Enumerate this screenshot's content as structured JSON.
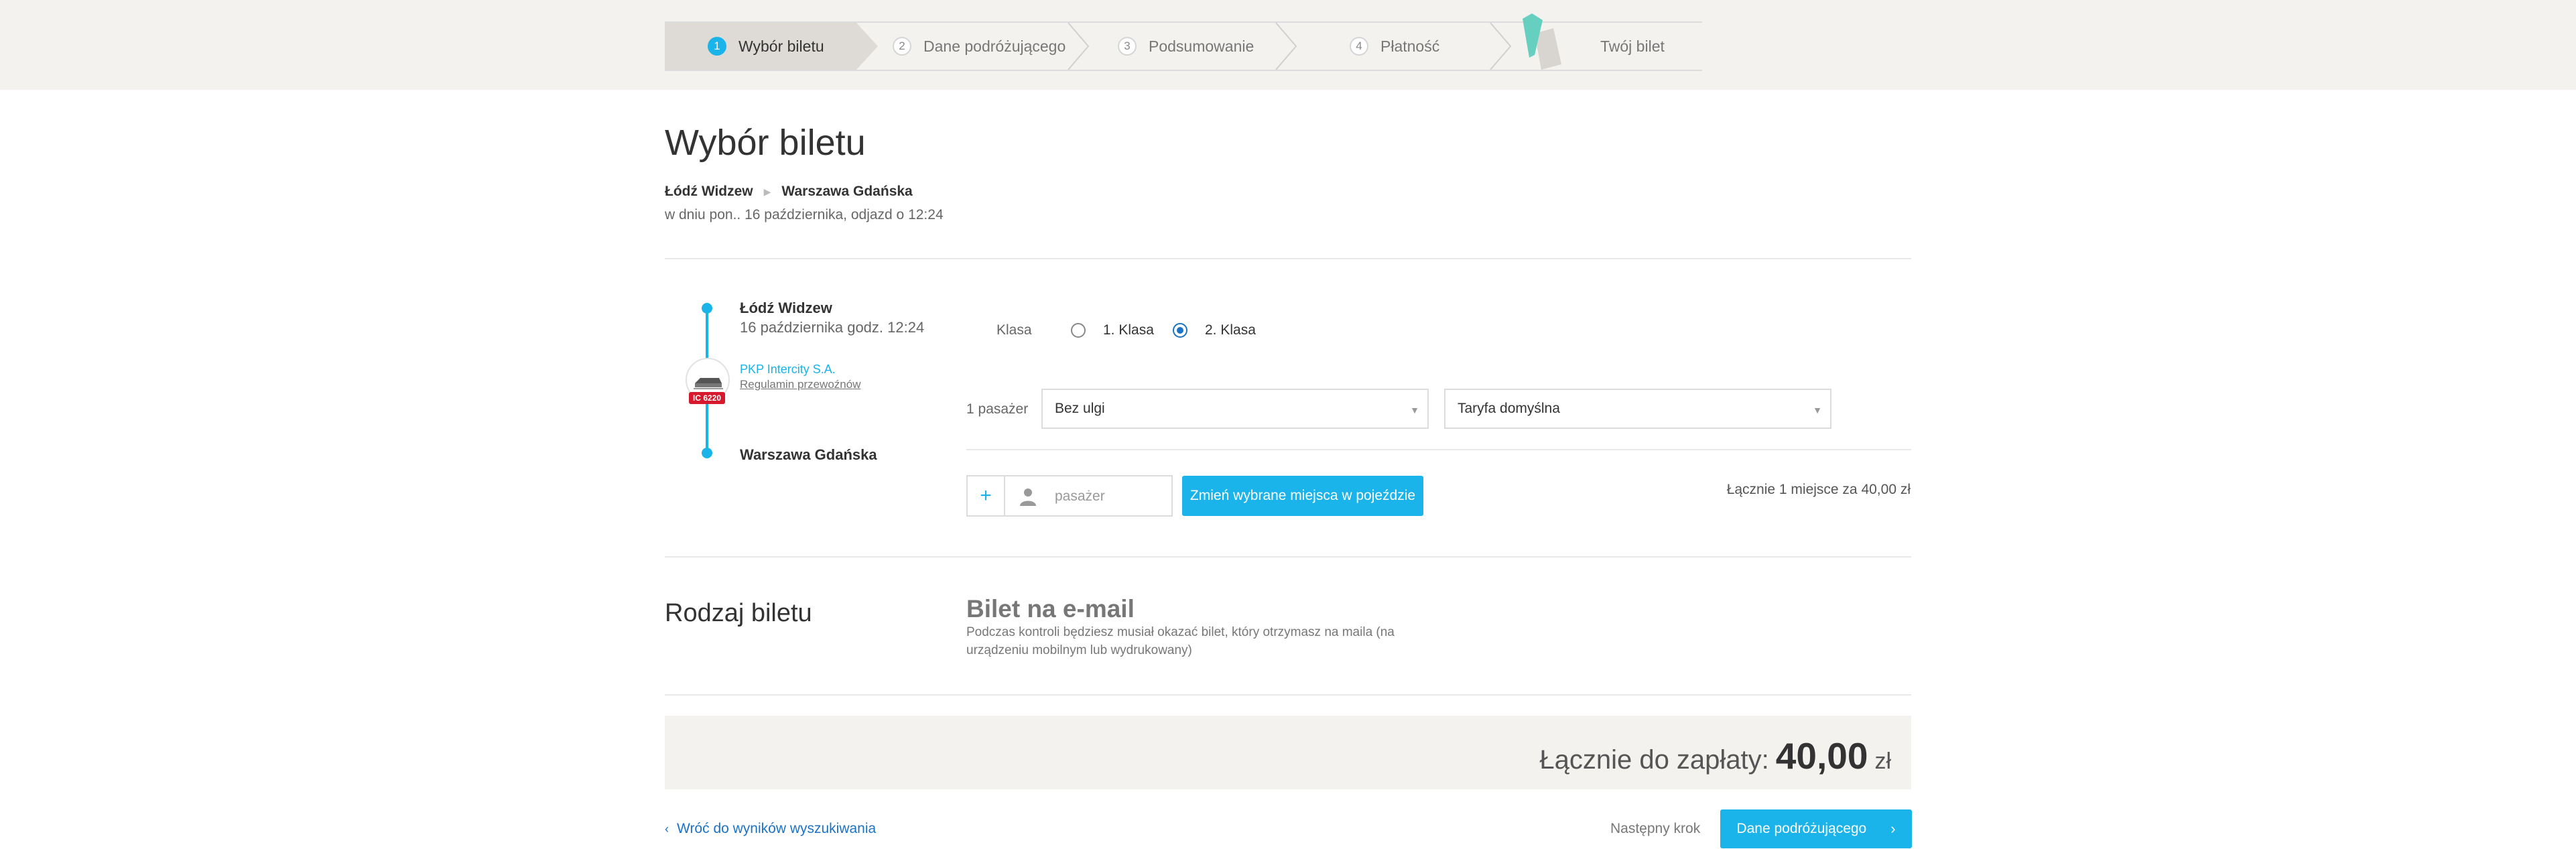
{
  "stepper": {
    "steps": [
      {
        "num": "1",
        "label": "Wybór biletu"
      },
      {
        "num": "2",
        "label": "Dane podróżującego"
      },
      {
        "num": "3",
        "label": "Podsumowanie"
      },
      {
        "num": "4",
        "label": "Płatność"
      },
      {
        "num": "",
        "label": "Twój bilet"
      }
    ],
    "active_index": 0
  },
  "page": {
    "title": "Wybór biletu",
    "route_from": "Łódź Widzew",
    "route_to": "Warszawa Gdańska",
    "route_subtitle": "w dniu pon.. 16 października, odjazd o 12:24"
  },
  "journey": {
    "departure_station": "Łódź Widzew",
    "departure_time": "16 października godz. 12:24",
    "carrier_name": "PKP Intercity S.A.",
    "carrier_rules": "Regulamin przewoźnów",
    "train_badge": "IC 6220",
    "arrival_station": "Warszawa Gdańska"
  },
  "klasa": {
    "label": "Klasa",
    "options": [
      "1. Klasa",
      "2. Klasa"
    ],
    "selected": "2. Klasa"
  },
  "passengers": {
    "count_label": "1 pasażer",
    "discount_value": "Bez ulgi",
    "tariff_value": "Taryfa domyślna",
    "add_placeholder": "pasażer",
    "change_seats_label": "Zmień wybrane miejsca w pojeździe",
    "seats_total": "Łącznie 1 miejsce za 40,00 zł"
  },
  "ticket_type": {
    "section_title": "Rodzaj biletu",
    "title": "Bilet na e-mail",
    "description": "Podczas kontroli będziesz musiał okazać bilet, który otrzymasz na maila (na urządzeniu mobilnym lub wydrukowany)"
  },
  "total": {
    "label": "Łącznie do zapłaty:",
    "amount": "40,00",
    "currency": "zł"
  },
  "footer": {
    "back_label": "Wróć do wyników wyszukiwania",
    "next_step_label": "Następny krok",
    "next_button_label": "Dane podróżującego"
  },
  "colors": {
    "accent": "#1ab3ea",
    "link": "#1a73c6",
    "band": "#f3f2ef",
    "badge": "#d7192d"
  }
}
